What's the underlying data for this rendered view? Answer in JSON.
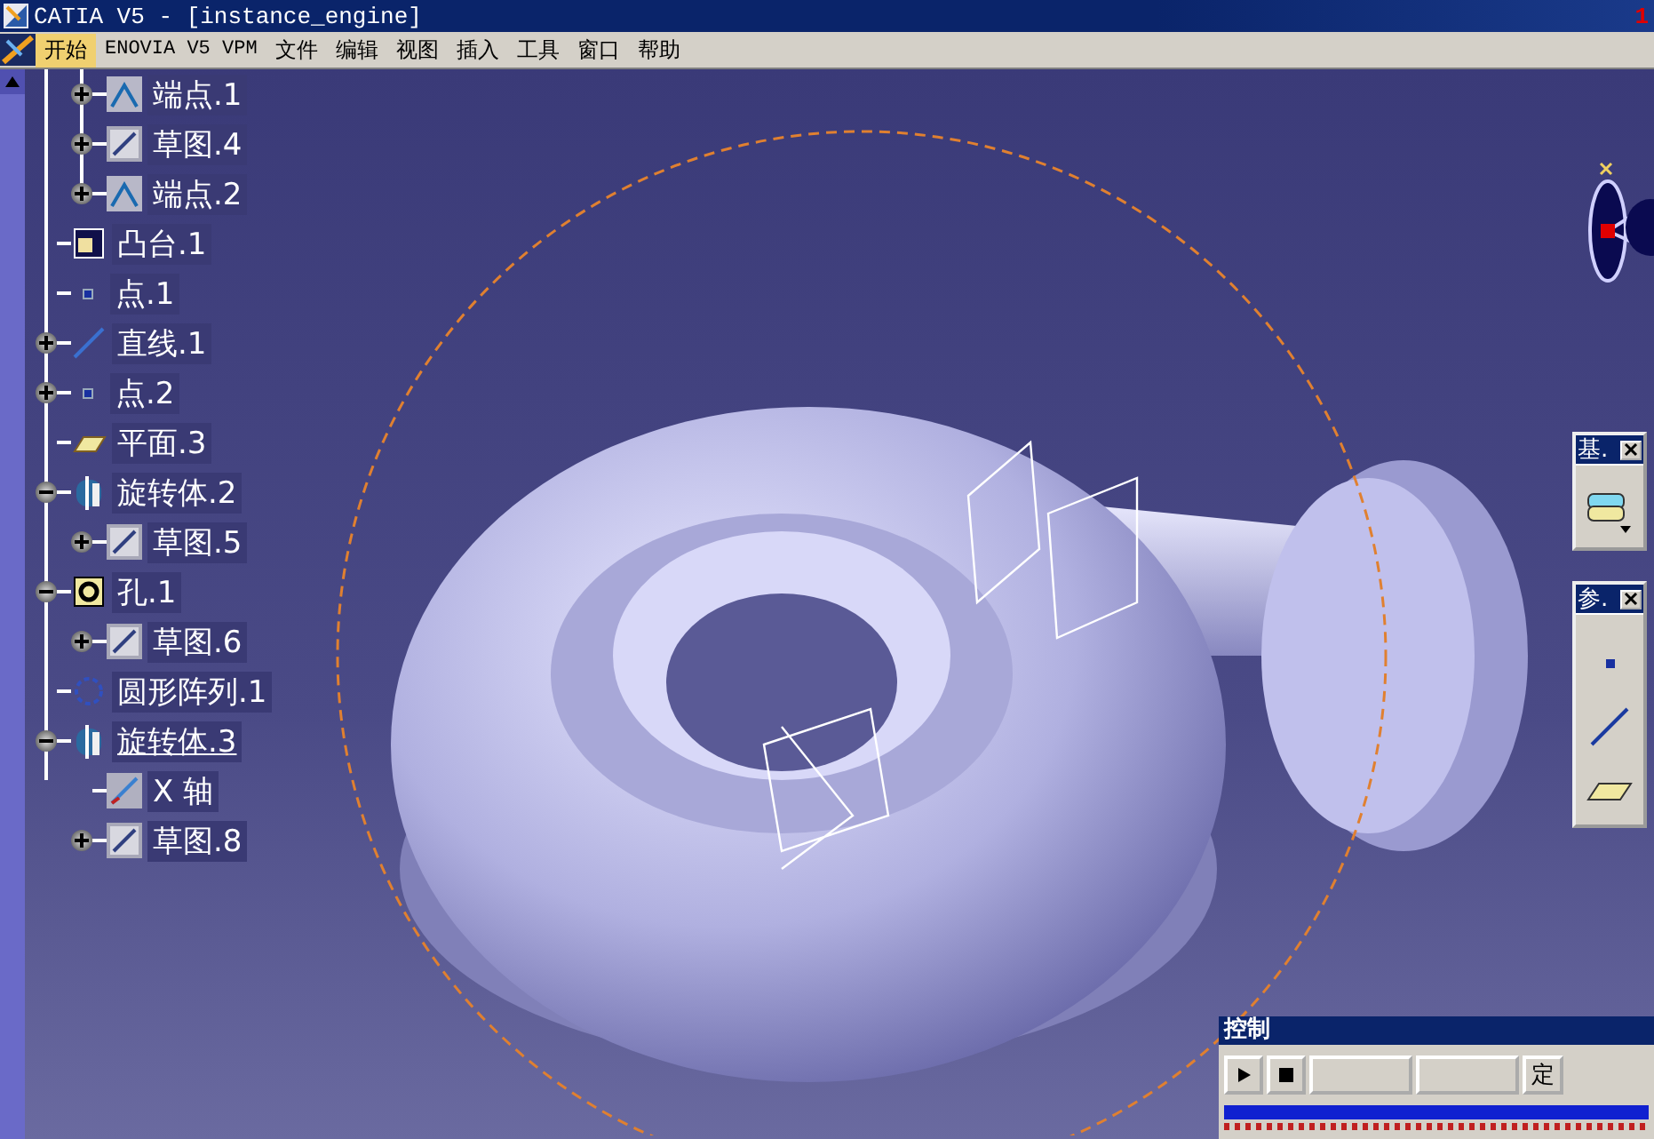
{
  "window": {
    "title": "CATIA V5 - [instance_engine]",
    "corner_mark": "1"
  },
  "menu": [
    {
      "label": "开始",
      "selected": true
    },
    {
      "label": "ENOVIA V5 VPM",
      "selected": false
    },
    {
      "label": "文件",
      "selected": false
    },
    {
      "label": "编辑",
      "selected": false
    },
    {
      "label": "视图",
      "selected": false
    },
    {
      "label": "插入",
      "selected": false
    },
    {
      "label": "工具",
      "selected": false
    },
    {
      "label": "窗口",
      "selected": false
    },
    {
      "label": "帮助",
      "selected": false
    }
  ],
  "tree": {
    "children_of_scrolled_parent": [
      {
        "label": "端点.1",
        "kind": "endpoint",
        "has_toggle": true,
        "expanded": false,
        "selected": false
      },
      {
        "label": "草图.4",
        "kind": "sketch",
        "has_toggle": true,
        "expanded": false,
        "selected": false
      },
      {
        "label": "端点.2",
        "kind": "endpoint",
        "has_toggle": true,
        "expanded": false,
        "selected": false
      }
    ],
    "items": [
      {
        "label": "凸台.1",
        "kind": "pad",
        "has_toggle": false,
        "selected": false
      },
      {
        "label": "点.1",
        "kind": "point",
        "has_toggle": false,
        "selected": false
      },
      {
        "label": "直线.1",
        "kind": "line",
        "has_toggle": true,
        "expanded": false,
        "selected": false
      },
      {
        "label": "点.2",
        "kind": "point",
        "has_toggle": true,
        "expanded": false,
        "selected": false
      },
      {
        "label": "平面.3",
        "kind": "plane",
        "has_toggle": false,
        "selected": false
      },
      {
        "label": "旋转体.2",
        "kind": "revolve",
        "has_toggle": true,
        "expanded": true,
        "selected": false,
        "children": [
          {
            "label": "草图.5",
            "kind": "sketch",
            "has_toggle": true,
            "expanded": false,
            "selected": false
          }
        ]
      },
      {
        "label": "孔.1",
        "kind": "hole",
        "has_toggle": true,
        "expanded": true,
        "selected": false,
        "children": [
          {
            "label": "草图.6",
            "kind": "sketch",
            "has_toggle": true,
            "expanded": false,
            "selected": false
          }
        ]
      },
      {
        "label": "圆形阵列.1",
        "kind": "pattern",
        "has_toggle": false,
        "selected": false
      },
      {
        "label": "旋转体.3",
        "kind": "revolve",
        "has_toggle": true,
        "expanded": true,
        "selected": true,
        "children": [
          {
            "label": "X 轴",
            "kind": "axis",
            "has_toggle": false,
            "selected": false
          },
          {
            "label": "草图.8",
            "kind": "sketch",
            "has_toggle": true,
            "expanded": false,
            "selected": false
          }
        ]
      }
    ]
  },
  "palettes": [
    {
      "title": "基.",
      "tools": [
        {
          "kind": "stack"
        }
      ]
    },
    {
      "title": "参.",
      "tools": [
        {
          "kind": "point"
        },
        {
          "kind": "line"
        },
        {
          "kind": "plane"
        }
      ]
    }
  ],
  "control_panel": {
    "title": "控制",
    "buttons": [
      {
        "kind": "play"
      },
      {
        "kind": "stop"
      },
      {
        "kind": "blank"
      },
      {
        "kind": "blank"
      },
      {
        "kind": "text",
        "label": "定"
      }
    ],
    "progress": {
      "level": 1
    }
  }
}
